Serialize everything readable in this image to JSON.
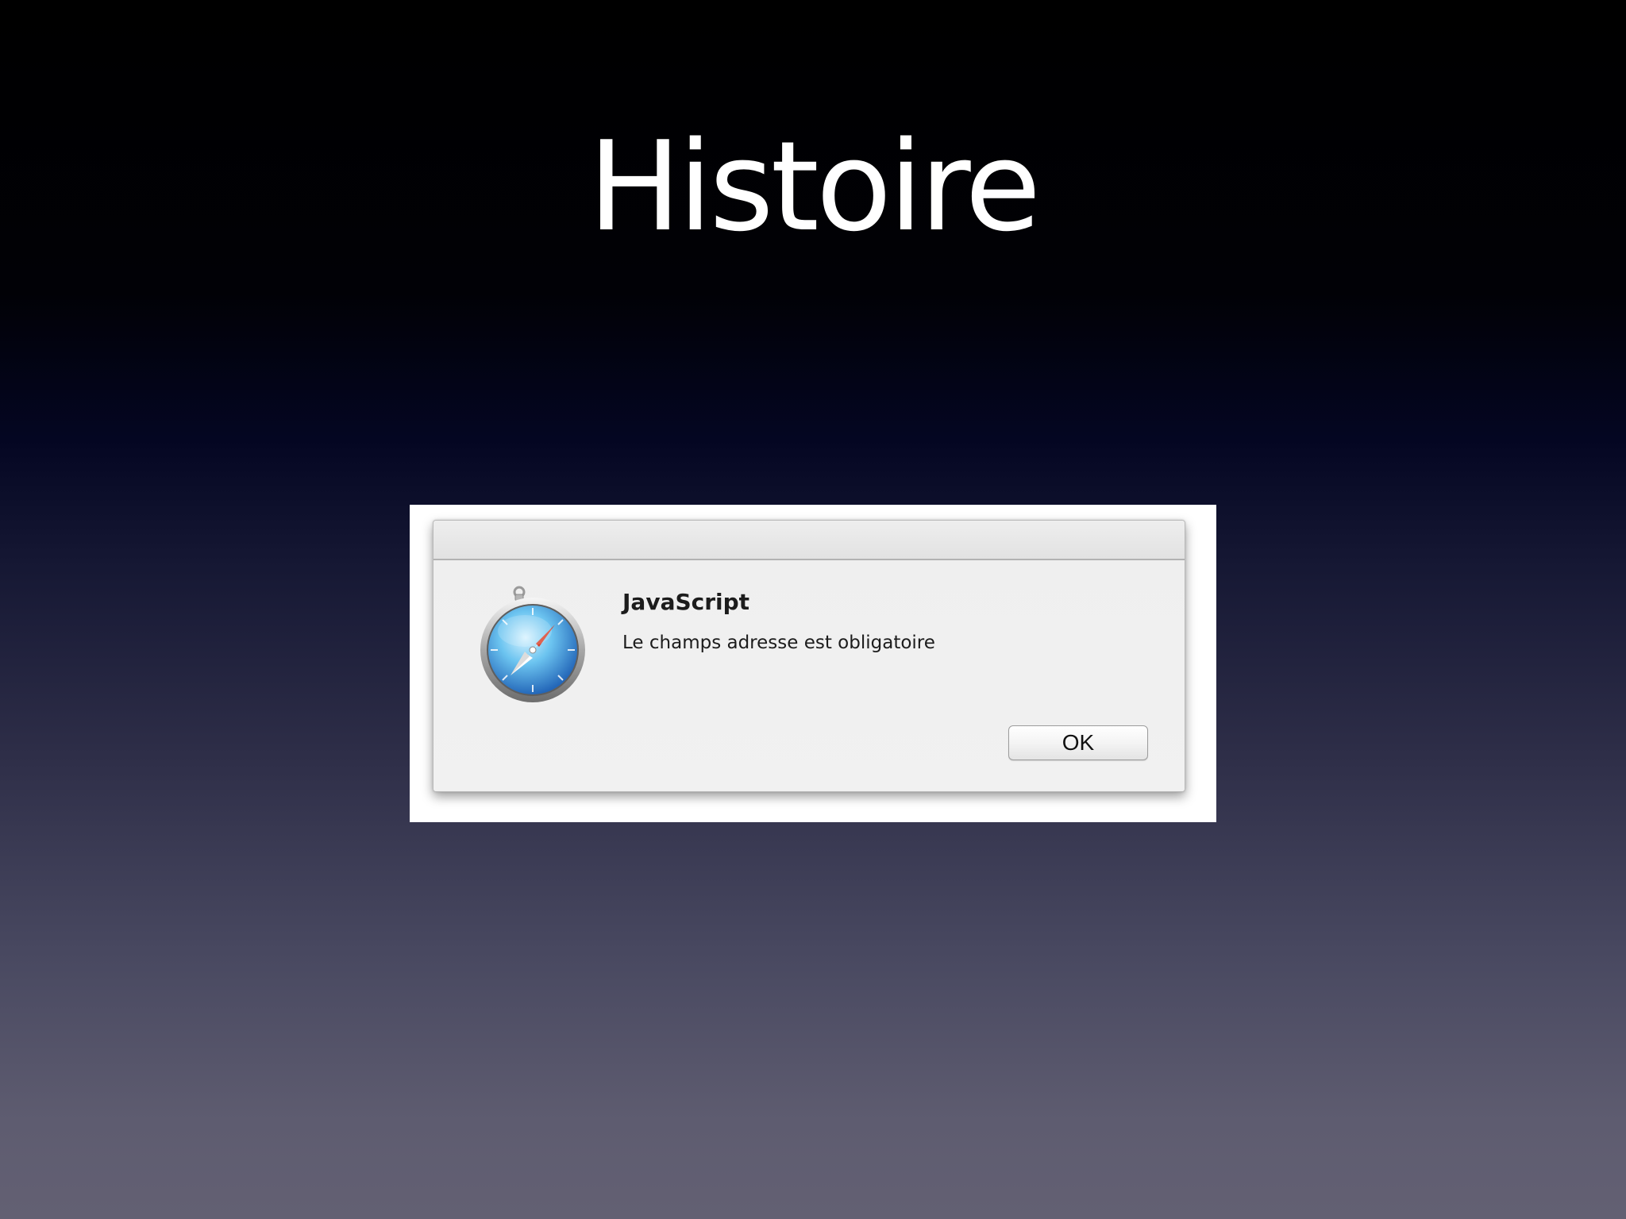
{
  "slide": {
    "title": "Histoire"
  },
  "dialog": {
    "title": "JavaScript",
    "message": "Le champs adresse est obligatoire",
    "ok_label": "OK",
    "icon": "safari-compass-icon"
  },
  "colors": {
    "title_text": "#ffffff",
    "dialog_background": "#ececec",
    "frame_background": "#ffffff",
    "compass_blue": "#3a9fe0",
    "compass_red_needle": "#d8402a"
  }
}
